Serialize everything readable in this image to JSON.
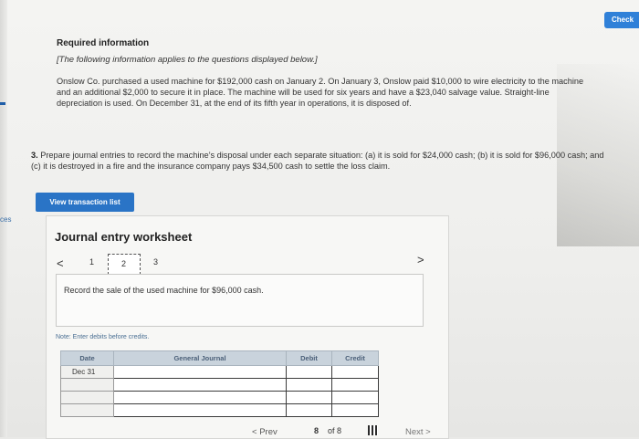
{
  "header": {
    "check_label": "Check"
  },
  "edge": {
    "label": "ces"
  },
  "info": {
    "title": "Required information",
    "subtitle": "[The following information applies to the questions displayed below.]",
    "body": "Onslow Co. purchased a used machine for $192,000 cash on January 2. On January 3, Onslow paid $10,000 to wire electricity to the machine and an additional $2,000 to secure it in place. The machine will be used for six years and have a $23,040 salvage value. Straight-line depreciation is used. On December 31, at the end of its fifth year in operations, it is disposed of."
  },
  "question": {
    "number": "3.",
    "text": "Prepare journal entries to record the machine’s disposal under each separate situation: (a) it is sold for $24,000 cash; (b) it is sold for $96,000 cash; and (c) it is destroyed in a fire and the insurance company pays $34,500 cash to settle the loss claim."
  },
  "view_button": "View transaction list",
  "worksheet": {
    "title": "Journal entry worksheet",
    "pages": [
      "1",
      "2",
      "3"
    ],
    "instruction": "Record the sale of the used machine for $96,000 cash.",
    "note": "Note: Enter debits before credits.",
    "columns": [
      "Date",
      "General Journal",
      "Debit",
      "Credit"
    ],
    "rows": [
      {
        "date": "Dec 31"
      },
      {
        "date": ""
      },
      {
        "date": ""
      },
      {
        "date": ""
      }
    ]
  },
  "footer": {
    "prev": "Prev",
    "current": "8",
    "of": "of 8",
    "next": "Next"
  }
}
